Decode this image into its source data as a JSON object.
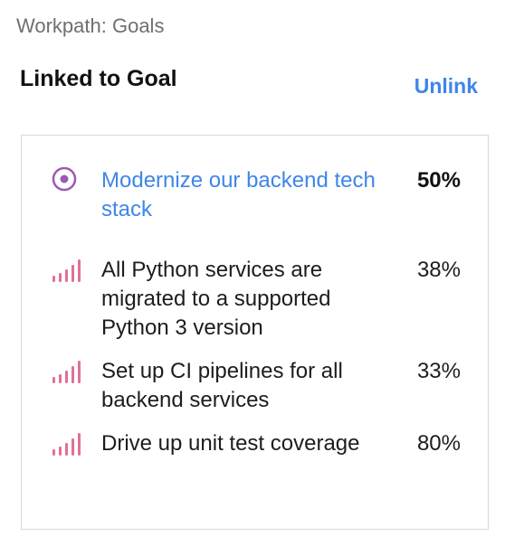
{
  "app": {
    "title": "Workpath: Goals"
  },
  "header": {
    "title": "Linked to Goal",
    "unlink_label": "Unlink"
  },
  "colors": {
    "link": "#3f86e8",
    "goal_icon": "#9b59b6",
    "kr_icon": "#e0709a",
    "border": "#d8d8d8"
  },
  "goal": {
    "icon": "target-circle-icon",
    "title": "Modernize our backend tech stack",
    "progress": "50%"
  },
  "key_results": [
    {
      "icon": "signal-bars-icon",
      "title": "All Python services are migrated to a supported Python 3 version",
      "progress": "38%"
    },
    {
      "icon": "signal-bars-icon",
      "title": "Set up CI pipelines for all backend services",
      "progress": "33%"
    },
    {
      "icon": "signal-bars-icon",
      "title": "Drive up unit test coverage",
      "progress": "80%"
    }
  ]
}
